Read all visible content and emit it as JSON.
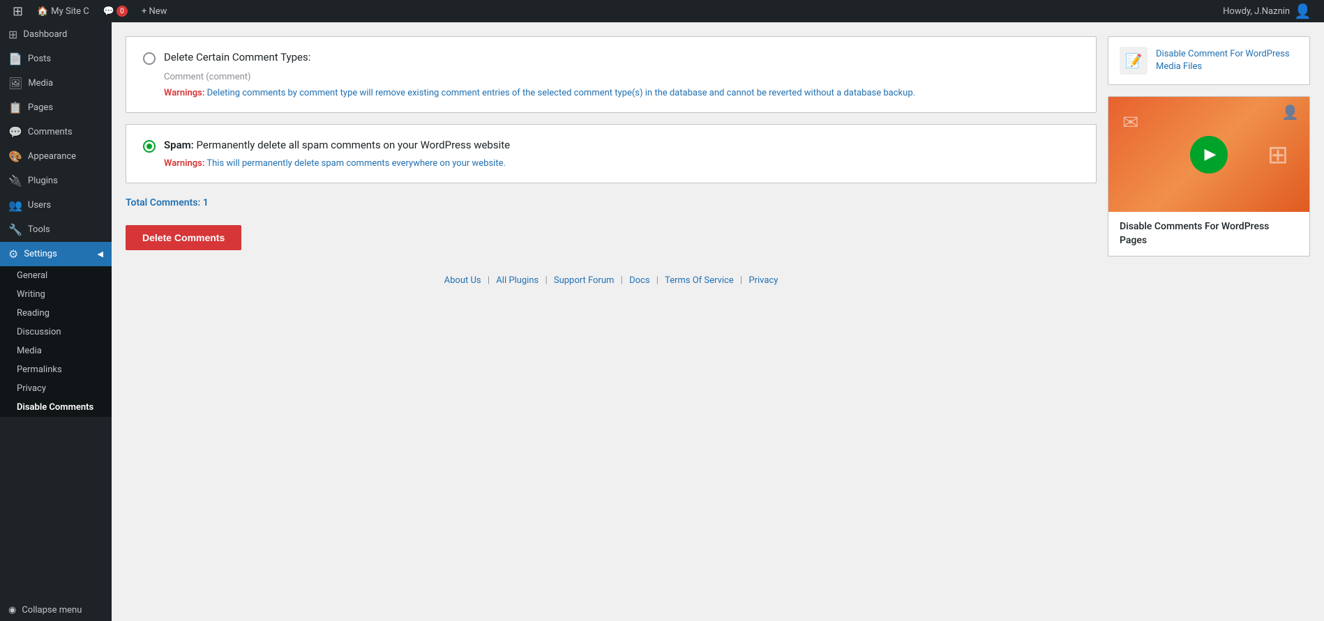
{
  "adminbar": {
    "wp_logo": "⊞",
    "site_name": "My Site C",
    "comments_label": "💬",
    "comments_count": "0",
    "new_label": "+ New",
    "howdy": "Howdy, J.Naznin",
    "user_icon": "👤"
  },
  "sidebar": {
    "items": [
      {
        "id": "dashboard",
        "label": "Dashboard",
        "icon": "⊞"
      },
      {
        "id": "posts",
        "label": "Posts",
        "icon": "📄"
      },
      {
        "id": "media",
        "label": "Media",
        "icon": "🖼"
      },
      {
        "id": "pages",
        "label": "Pages",
        "icon": "📋"
      },
      {
        "id": "comments",
        "label": "Comments",
        "icon": "💬"
      },
      {
        "id": "appearance",
        "label": "Appearance",
        "icon": "🎨"
      },
      {
        "id": "plugins",
        "label": "Plugins",
        "icon": "🔌"
      },
      {
        "id": "users",
        "label": "Users",
        "icon": "👥"
      },
      {
        "id": "tools",
        "label": "Tools",
        "icon": "🔧"
      },
      {
        "id": "settings",
        "label": "Settings",
        "icon": "⚙"
      }
    ],
    "settings_submenu": [
      {
        "id": "general",
        "label": "General"
      },
      {
        "id": "writing",
        "label": "Writing"
      },
      {
        "id": "reading",
        "label": "Reading"
      },
      {
        "id": "discussion",
        "label": "Discussion"
      },
      {
        "id": "media",
        "label": "Media"
      },
      {
        "id": "permalinks",
        "label": "Permalinks"
      },
      {
        "id": "privacy",
        "label": "Privacy"
      },
      {
        "id": "disable-comments",
        "label": "Disable Comments"
      }
    ],
    "collapse_label": "Collapse menu"
  },
  "main": {
    "card1": {
      "title": "Delete Certain Comment Types:",
      "subtitle": "Comment (comment)",
      "warning_label": "Warnings:",
      "warning_text": "Deleting comments by comment type will remove existing comment entries of the selected comment type(s) in the database and cannot be reverted without a database backup."
    },
    "card2": {
      "spam_label": "Spam:",
      "spam_text": "Permanently delete all spam comments on your WordPress website",
      "warning_label": "Warnings:",
      "warning_text": "This will permanently delete spam comments everywhere on your website."
    },
    "total_comments": "Total Comments: 1",
    "delete_button": "Delete Comments"
  },
  "footer": {
    "links": [
      {
        "label": "About Us"
      },
      {
        "label": "All Plugins"
      },
      {
        "label": "Support Forum"
      },
      {
        "label": "Docs"
      },
      {
        "label": "Terms Of Service"
      },
      {
        "label": "Privacy"
      }
    ]
  },
  "right_sidebar": {
    "plugin_widget": {
      "icon": "📝",
      "title": "Disable Comment For WordPress Media Files"
    },
    "video_widget": {
      "title": "Disable Comments For WordPress Pages"
    }
  }
}
